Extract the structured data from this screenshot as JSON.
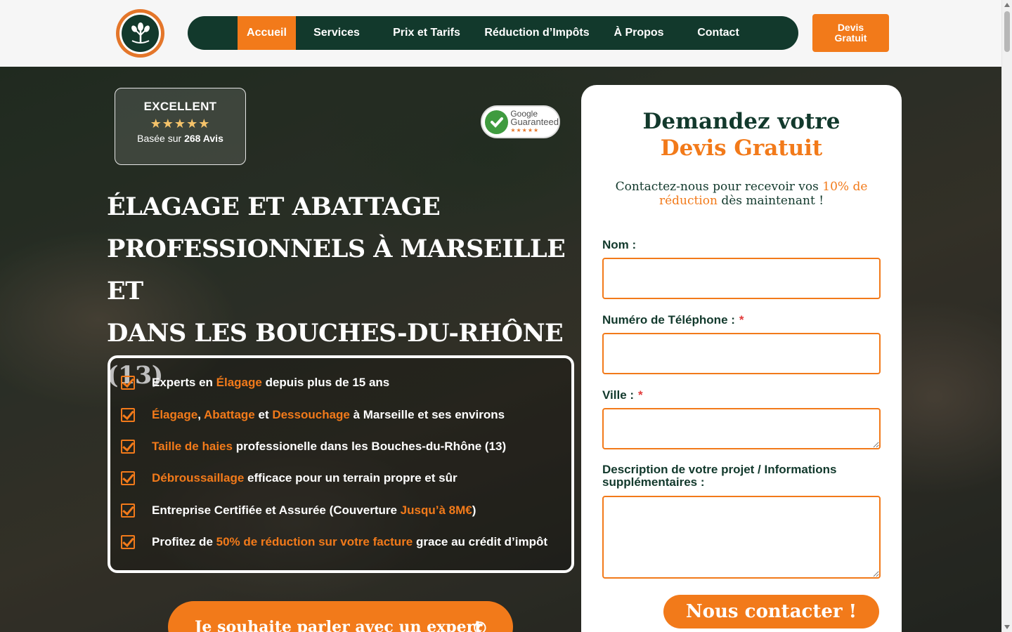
{
  "header": {
    "nav": [
      {
        "label": "Accueil",
        "active": true
      },
      {
        "label": "Services",
        "active": false
      },
      {
        "label": "Prix et Tarifs",
        "active": false
      },
      {
        "label": "Réduction d’Impôts",
        "active": false
      },
      {
        "label": "À Propos",
        "active": false
      },
      {
        "label": "Contact",
        "active": false
      }
    ],
    "cta": "Devis Gratuit"
  },
  "reviews": {
    "rating_label": "EXCELLENT",
    "stars": "★★★★★",
    "based_on": "Basée sur",
    "count": "268 Avis"
  },
  "google_badge": {
    "line1": "Google",
    "line2": "Guaranteed",
    "stars": "★★★★★"
  },
  "hero": {
    "title_line1": "ÉLAGAGE ET ABATTAGE",
    "title_line2": "PROFESSIONNELS À MARSEILLE ET",
    "title_line3": "DANS LES BOUCHES-DU-RHÔNE (13)",
    "features": [
      {
        "parts": [
          {
            "t": "Experts en ",
            "hl": false
          },
          {
            "t": "Élagage",
            "hl": true
          },
          {
            "t": " depuis plus de 15 ans",
            "hl": false
          }
        ]
      },
      {
        "parts": [
          {
            "t": "Élagage",
            "hl": true
          },
          {
            "t": ", ",
            "hl": false
          },
          {
            "t": "Abattage",
            "hl": true
          },
          {
            "t": " et ",
            "hl": false
          },
          {
            "t": "Dessouchage",
            "hl": true
          },
          {
            "t": " à Marseille et ses environs",
            "hl": false
          }
        ]
      },
      {
        "parts": [
          {
            "t": "Taille de haies",
            "hl": true
          },
          {
            "t": " professionelle dans les Bouches-du-Rhône (13)",
            "hl": false
          }
        ]
      },
      {
        "parts": [
          {
            "t": "Débroussaillage",
            "hl": true
          },
          {
            "t": " efficace pour un terrain propre et sûr",
            "hl": false
          }
        ]
      },
      {
        "parts": [
          {
            "t": "Entreprise Certifiée et Assurée (Couverture ",
            "hl": false
          },
          {
            "t": "Jusqu’à 8M€",
            "hl": true
          },
          {
            "t": ")",
            "hl": false
          }
        ]
      },
      {
        "parts": [
          {
            "t": "Profitez de ",
            "hl": false
          },
          {
            "t": "50% de réduction sur votre facture",
            "hl": true
          },
          {
            "t": " grace au crédit d’impôt",
            "hl": false
          }
        ]
      }
    ],
    "expert_button": "Je souhaite parler avec un expert"
  },
  "form": {
    "title_line1": "Demandez votre",
    "title_line2": "Devis Gratuit",
    "subtitle_a": "Contactez-nous pour recevoir vos ",
    "subtitle_hl": "10% de réduction",
    "subtitle_b": " dès maintenant !",
    "fields": [
      {
        "label": "Nom :",
        "required": false,
        "value": ""
      },
      {
        "label": "Numéro de Téléphone :",
        "required": true,
        "value": ""
      },
      {
        "label": "Ville :",
        "required": true,
        "value": ""
      },
      {
        "label": "Description de votre projet / Informations supplémentaires :",
        "required": false,
        "value": ""
      }
    ],
    "required_mark": "*",
    "submit": "Nous contacter !"
  },
  "colors": {
    "primary_green": "#12392c",
    "accent_orange": "#f27a1a"
  }
}
